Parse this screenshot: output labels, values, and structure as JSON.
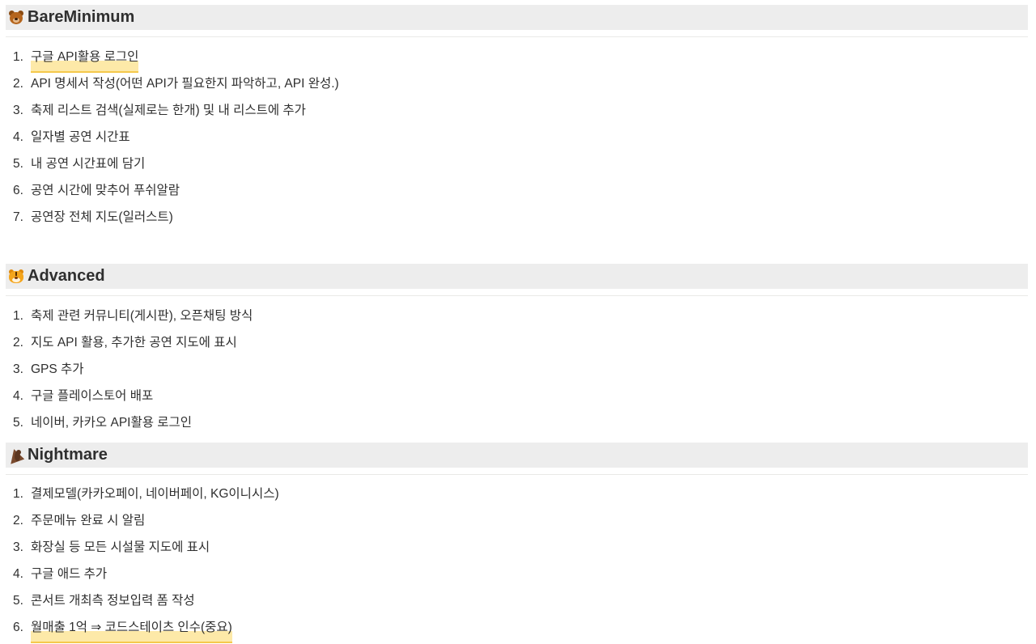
{
  "sections": [
    {
      "title": "BareMinimum",
      "icon": "bear-icon",
      "items": [
        {
          "num": "1.",
          "text": "구글 API활용 로그인",
          "highlight": true
        },
        {
          "num": "2.",
          "text": "API 명세서 작성(어떤 API가 필요한지 파악하고, API 완성.)",
          "highlight": false
        },
        {
          "num": "3.",
          "text": "축제 리스트 검색(실제로는 한개) 및 내 리스트에 추가",
          "highlight": false
        },
        {
          "num": "4.",
          "text": "일자별 공연 시간표",
          "highlight": false
        },
        {
          "num": "5.",
          "text": "내 공연 시간표에 담기",
          "highlight": false
        },
        {
          "num": "6.",
          "text": "공연 시간에 맞추어 푸쉬알람",
          "highlight": false
        },
        {
          "num": "7.",
          "text": "공연장 전체 지도(일러스트)",
          "highlight": false
        }
      ]
    },
    {
      "title": "Advanced",
      "icon": "tiger-icon",
      "items": [
        {
          "num": "1.",
          "text": "축제 관련 커뮤니티(게시판), 오픈채팅 방식",
          "highlight": false
        },
        {
          "num": "2.",
          "text": "지도 API 활용, 추가한 공연 지도에 표시",
          "highlight": false
        },
        {
          "num": "3.",
          "text": "GPS 추가",
          "highlight": false
        },
        {
          "num": "4.",
          "text": "구글 플레이스토어 배포",
          "highlight": false
        },
        {
          "num": "5.",
          "text": "네이버, 카카오 API활용 로그인",
          "highlight": false
        }
      ]
    },
    {
      "title": "Nightmare",
      "icon": "bat-icon",
      "items": [
        {
          "num": "1.",
          "text": "결제모델(카카오페이, 네이버페이, KG이니시스)",
          "highlight": false
        },
        {
          "num": "2.",
          "text": "주문메뉴 완료 시 알림",
          "highlight": false
        },
        {
          "num": "3.",
          "text": "화장실 등 모든 시설물 지도에 표시",
          "highlight": false
        },
        {
          "num": "4.",
          "text": "구글 애드 추가",
          "highlight": false
        },
        {
          "num": "5.",
          "text": "콘서트 개최측 정보입력 폼 작성",
          "highlight": false
        },
        {
          "num": "6.",
          "text": "월매출 1억 ⇒ 코드스테이츠 인수(중요)",
          "highlight": true
        }
      ]
    }
  ],
  "colors": {
    "header_bg": "#ededed",
    "text": "#2f2f2f",
    "highlight_fill": "#fde9a8",
    "highlight_underline": "#f5c94c"
  }
}
